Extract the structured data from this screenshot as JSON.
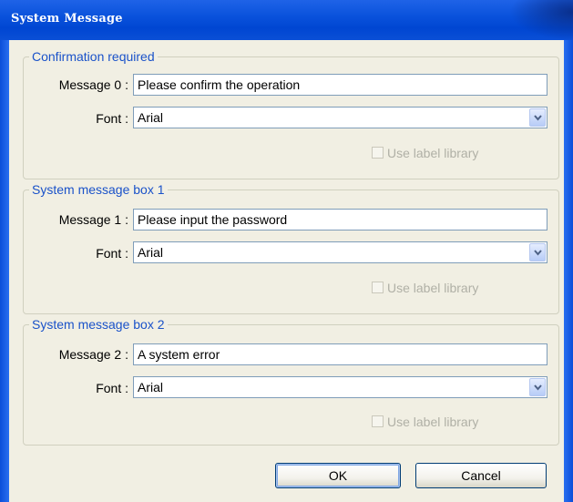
{
  "window": {
    "title": "System Message"
  },
  "groups": [
    {
      "legend": "Confirmation required",
      "message_label": "Message 0 :",
      "message_value": "Please confirm the operation",
      "font_label": "Font :",
      "font_value": "Arial",
      "checkbox_label": "Use label library",
      "checkbox_checked": false,
      "checkbox_enabled": false
    },
    {
      "legend": "System message box 1",
      "message_label": "Message 1 :",
      "message_value": "Please input the password",
      "font_label": "Font :",
      "font_value": "Arial",
      "checkbox_label": "Use label library",
      "checkbox_checked": false,
      "checkbox_enabled": false
    },
    {
      "legend": "System message box 2",
      "message_label": "Message 2 :",
      "message_value": "A system error",
      "font_label": "Font :",
      "font_value": "Arial",
      "checkbox_label": "Use label library",
      "checkbox_checked": false,
      "checkbox_enabled": false
    }
  ],
  "buttons": {
    "ok": "OK",
    "cancel": "Cancel"
  },
  "colors": {
    "title_bar": "#0a52dc",
    "group_legend": "#1a52c9",
    "dialog_face": "#f1efe3"
  }
}
